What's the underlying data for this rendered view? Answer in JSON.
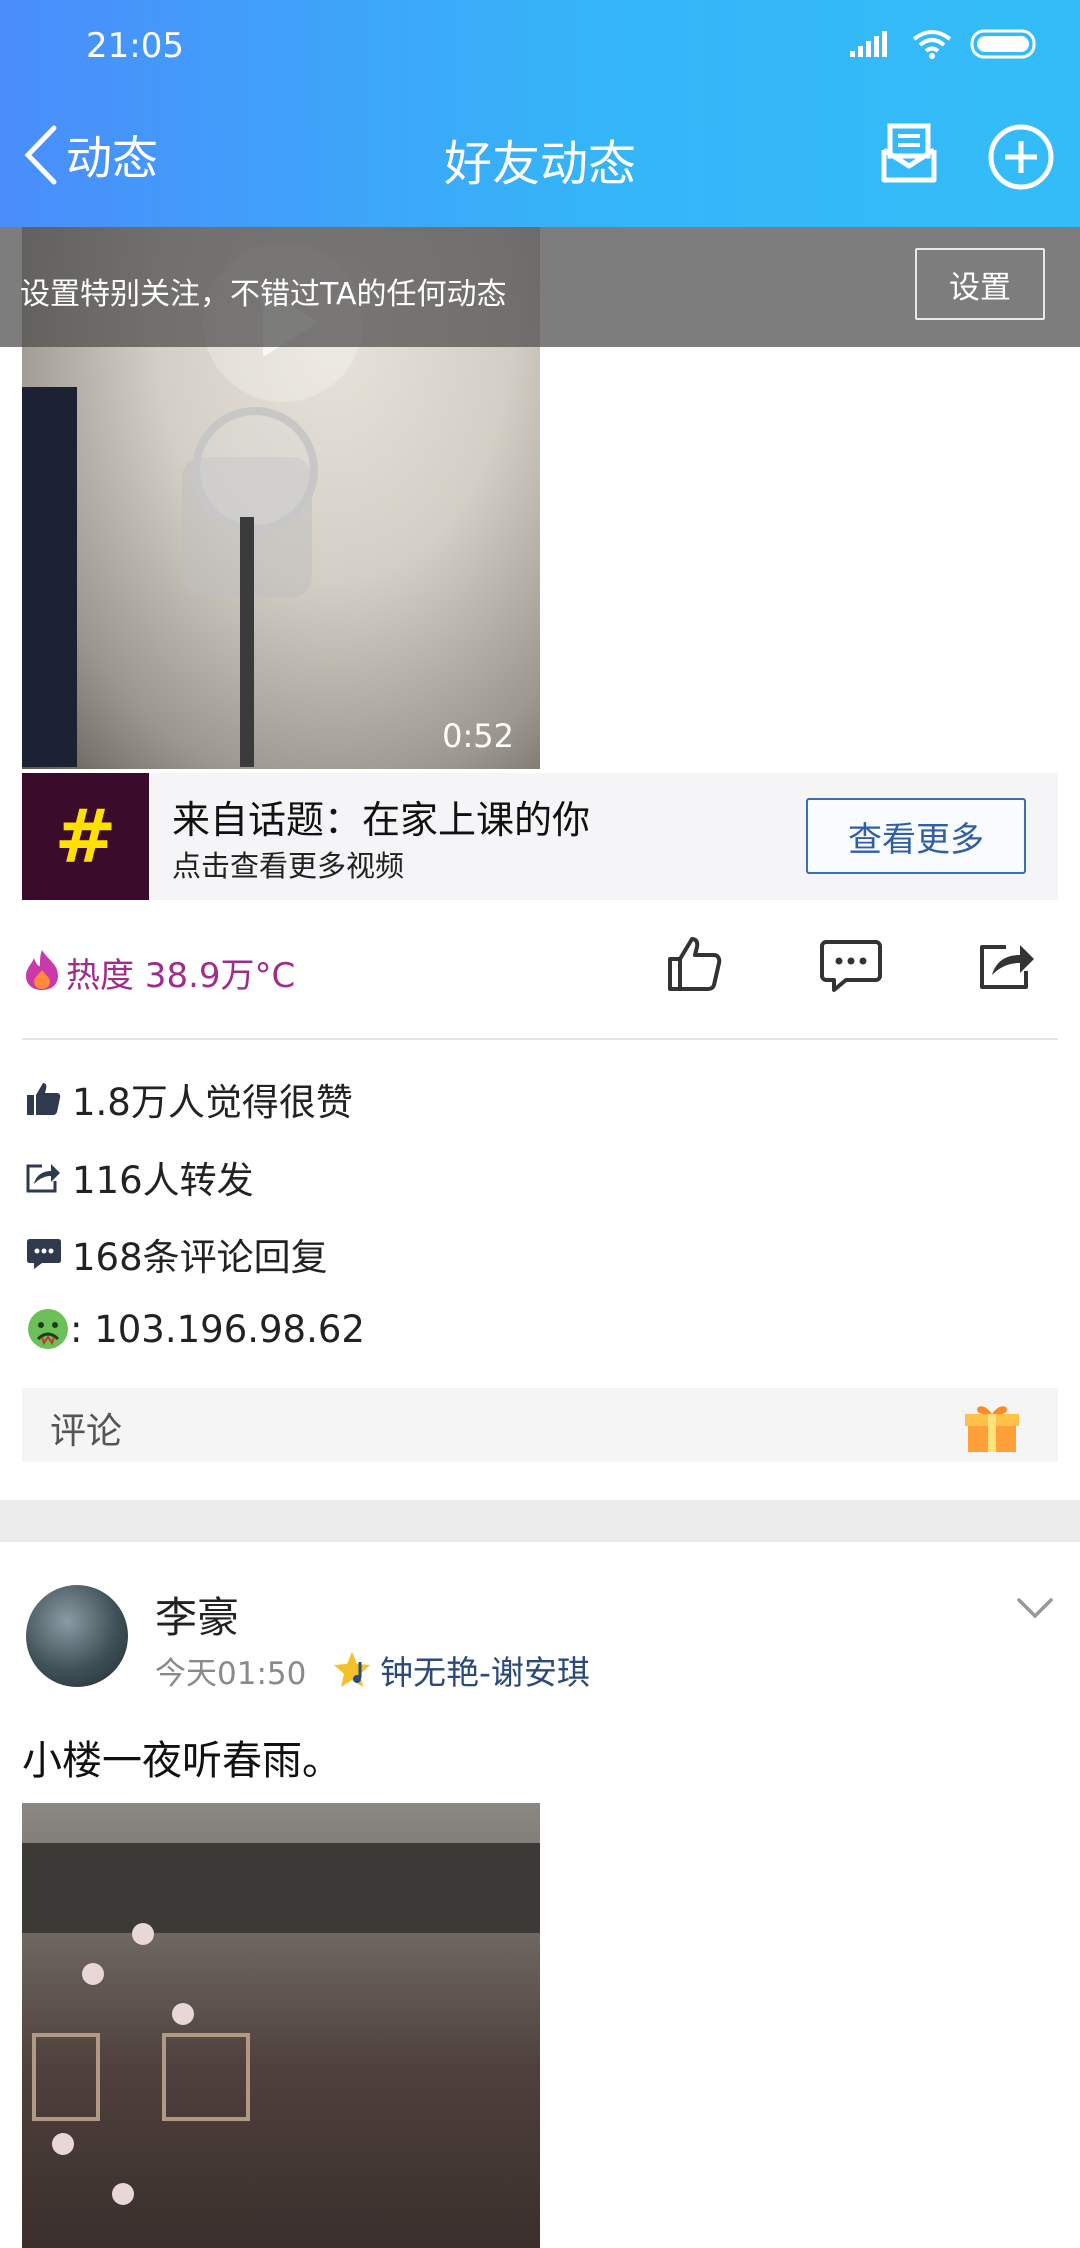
{
  "status_bar": {
    "time": "21:05"
  },
  "header": {
    "back_label": "动态",
    "title": "好友动态"
  },
  "banner": {
    "text": "设置特别关注，不错过TA的任何动态",
    "button": "设置"
  },
  "video": {
    "duration": "0:52"
  },
  "topic_card": {
    "title": "来自话题：在家上课的你",
    "subtitle": "点击查看更多视频",
    "button": "查看更多"
  },
  "actions": {
    "heat": "热度 38.9万°C"
  },
  "stats": {
    "likes": "1.8万人觉得很赞",
    "shares": "116人转发",
    "comments": "168条评论回复",
    "ip": ": 103.196.98.62"
  },
  "comment_bar": {
    "placeholder": "评论"
  },
  "post2": {
    "username": "李豪",
    "time": "今天01:50",
    "topic_tag": "钟无艳-谢安琪",
    "text": "小楼一夜听春雨。"
  },
  "colors": {
    "header_start": "#4a8dfb",
    "header_end": "#33bdf7",
    "heat": "#9e2d8c",
    "topic_button": "#3a6fb4",
    "tag_text": "#2b4a7a"
  }
}
